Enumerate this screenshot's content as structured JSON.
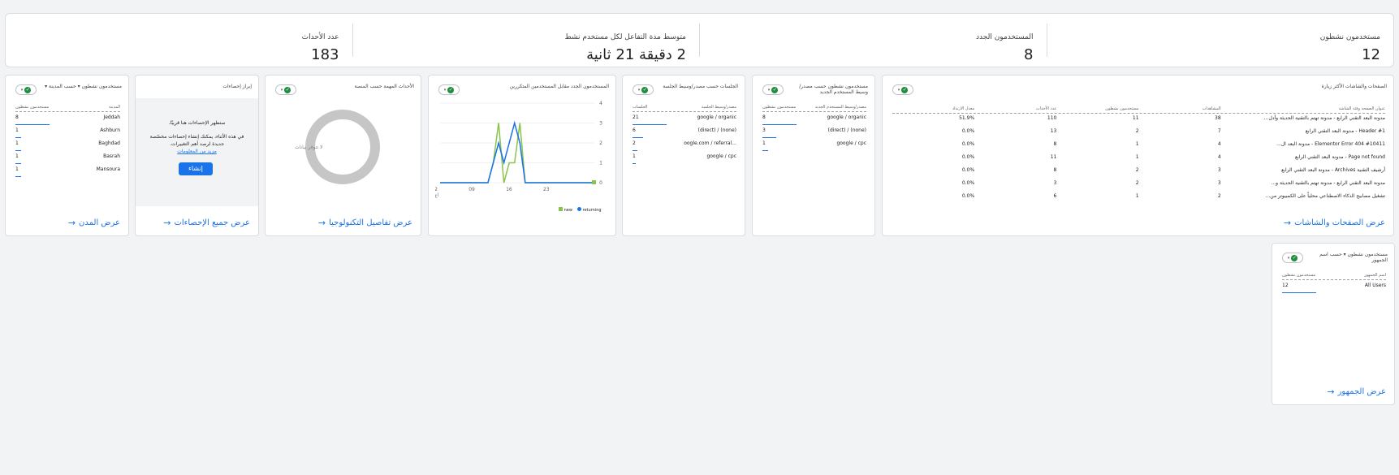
{
  "kpis": [
    {
      "label": "مستخدمون نشطون",
      "value": "12"
    },
    {
      "label": "المستخدمون الجدد",
      "value": "8"
    },
    {
      "label": "متوسط مدة التفاعل لكل مستخدم نشط",
      "value": "2 دقيقة 21 ثانية"
    },
    {
      "label": "عدد الأحداث",
      "value": "183"
    }
  ],
  "pages_card": {
    "title": "الصفحات والشاشات الأكثر زيارة",
    "headers": [
      "عنوان الصفحة وفئة الشاشة",
      "المشاهدات",
      "مستخدمون نشطون",
      "عدد الأحداث",
      "معدل الارتداد"
    ],
    "rows": [
      [
        "مدونة البعد التقني الرابع - مدونة تهتم بالتقنية الحديثة وأدل...",
        "38",
        "11",
        "110",
        "51.9%"
      ],
      [
        "Header #1 - مدونة البعد التقني الرابع",
        "7",
        "2",
        "13",
        "0.0%"
      ],
      [
        "Elementor Error 404 #10411 - مدونة البعد ال...",
        "4",
        "1",
        "8",
        "0.0%"
      ],
      [
        "Page not found - مدونة البعد التقني الرابع",
        "4",
        "1",
        "11",
        "0.0%"
      ],
      [
        "أرشيف التقنية Archives - مدونة البعد التقني الرابع",
        "3",
        "2",
        "8",
        "0.0%"
      ],
      [
        "مدونة البعد التقني الرابع - مدونة تهتم بالتقنية الحديثة و...",
        "3",
        "2",
        "3",
        "0.0%"
      ],
      [
        "تشغيل مصابيح الذكاء الاصطناعي محلياً على الكمبيوتر من...",
        "2",
        "1",
        "6",
        "0.0%"
      ]
    ],
    "footer": "عرض الصفحات والشاشات"
  },
  "users_by_source": {
    "title": "مستخدمون نشطون حسب مصدر/وسيط المستخدم الجديد",
    "headers": [
      "مصدر/وسيط المستخدم الجديد",
      "مستخدمون نشطون"
    ],
    "rows": [
      [
        "google / organic",
        "8"
      ],
      [
        "(none) / (direct)",
        "3"
      ],
      [
        "google / cpc",
        "1"
      ]
    ]
  },
  "sessions_by_source": {
    "title": "الجلسات حسب مصدر/وسيط الجلسة",
    "headers": [
      "مصدر/وسيط الجلسة",
      "الجلسات"
    ],
    "rows": [
      [
        "google / organic",
        "21"
      ],
      [
        "(none) / (direct)",
        "6"
      ],
      [
        "...oogle.com / referral",
        "2"
      ],
      [
        "google / cpc",
        "1"
      ]
    ]
  },
  "new_vs_returning": {
    "title": "المستخدمون الجدد مقابل المستخدمين المتكررين",
    "yticks": [
      "4",
      "3",
      "2",
      "1",
      "0"
    ],
    "xticks": [
      "2",
      "09",
      "16",
      "23"
    ],
    "xsub": "أغ",
    "legend": [
      "returning",
      "new"
    ],
    "colors": {
      "returning": "#1a73e8",
      "new": "#8bc34a"
    }
  },
  "chart_data": {
    "type": "line",
    "title": "المستخدمون الجدد مقابل المستخدمين المتكررين",
    "xlabel": "",
    "ylabel": "",
    "x": [
      2,
      3,
      4,
      5,
      6,
      7,
      8,
      9,
      10,
      11,
      12,
      13,
      14,
      15,
      16,
      17,
      18,
      19,
      20,
      21,
      22,
      23,
      24,
      25,
      26,
      27,
      28,
      29,
      30,
      31
    ],
    "series": [
      {
        "name": "returning",
        "values": [
          0,
          0,
          0,
          0,
          0,
          0,
          0,
          0,
          0,
          0,
          1,
          2,
          1,
          2,
          3,
          2,
          0,
          0,
          0,
          0,
          0,
          0,
          0,
          0,
          0,
          0,
          0,
          0,
          0,
          0
        ]
      },
      {
        "name": "new",
        "values": [
          0,
          0,
          0,
          0,
          0,
          0,
          0,
          0,
          0,
          0,
          1,
          3,
          0,
          1,
          1,
          3,
          0,
          0,
          0,
          0,
          0,
          0,
          0,
          0,
          0,
          0,
          0,
          0,
          0,
          0
        ]
      }
    ],
    "ylim": [
      0,
      4
    ]
  },
  "events_card": {
    "title": "الأحداث المهمة حسب المنصة",
    "empty": "لا تتوفر بيانات",
    "footer": "عرض تفاصيل التكنولوجيا"
  },
  "stats_card": {
    "title": "إبراز إحصاءات",
    "line1": "ستظهر الإحصاءات هنا قريبًا.",
    "line2": "في هذه الأثناء، يمكنك إنشاء إحصاءات مخصّصة جديدة لرصد أهم التغييرات.",
    "link": "مزيد من المعلومات",
    "button": "إنشاء",
    "footer": "عرض جميع الإحصاءات"
  },
  "cities_card": {
    "title": "مستخدمون نشطون ▾ حسب المدينة ▾",
    "headers": [
      "المدينة",
      "مستخدمون نشطون"
    ],
    "rows": [
      [
        "Jeddah",
        "8"
      ],
      [
        "Ashburn",
        "1"
      ],
      [
        "Baghdad",
        "1"
      ],
      [
        "Basrah",
        "1"
      ],
      [
        "Mansoura",
        "1"
      ]
    ],
    "footer": "عرض المدن"
  },
  "audience_card": {
    "title": "مستخدمون نشطون ▾ حسب اسم الجمهور",
    "headers": [
      "اسم الجمهور",
      "مستخدمون نشطون"
    ],
    "rows": [
      [
        "All Users",
        "12"
      ]
    ],
    "footer": "عرض الجمهور"
  }
}
